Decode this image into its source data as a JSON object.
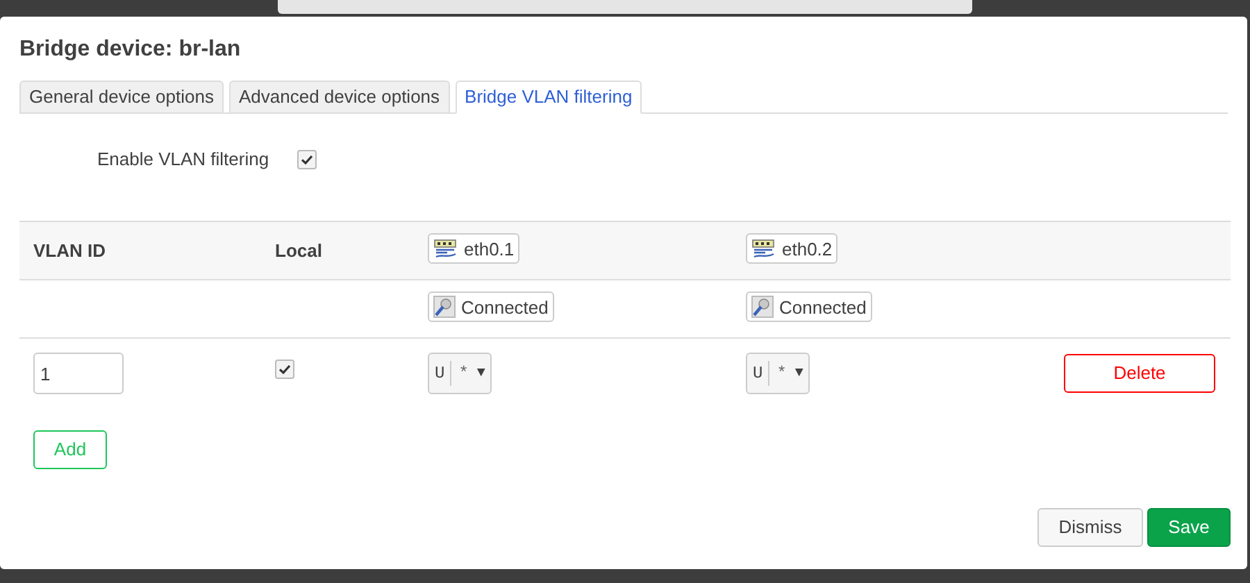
{
  "dialog": {
    "title": "Bridge device: br-lan"
  },
  "tabs": [
    {
      "label": "General device options",
      "selected": false
    },
    {
      "label": "Advanced device options",
      "selected": false
    },
    {
      "label": "Bridge VLAN filtering",
      "selected": true
    }
  ],
  "vlan_filtering": {
    "label": "Enable VLAN filtering",
    "checked": true
  },
  "table": {
    "columns": [
      "VLAN ID",
      "Local"
    ],
    "ports": [
      {
        "name": "eth0.1",
        "status": "Connected"
      },
      {
        "name": "eth0.2",
        "status": "Connected"
      }
    ],
    "rows": [
      {
        "vlan_id": "1",
        "local": true,
        "ports": [
          {
            "tag": "U",
            "pvid": "*",
            "arrow": "▼"
          },
          {
            "tag": "U",
            "pvid": "*",
            "arrow": "▼"
          }
        ],
        "delete": "Delete"
      }
    ]
  },
  "add_button": "Add",
  "buttons": [
    {
      "label": "Dismiss",
      "kind": "neutral"
    },
    {
      "label": "Save",
      "kind": "primary"
    }
  ]
}
